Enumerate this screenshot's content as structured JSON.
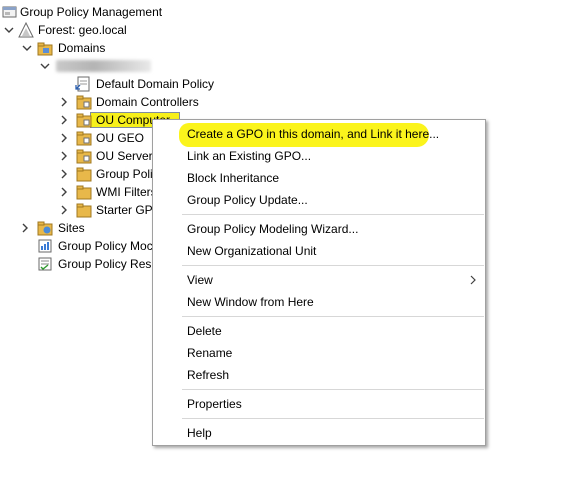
{
  "tree": {
    "root_label": "Group Policy Management",
    "forest_label": "Forest: geo.local",
    "domains_label": "Domains",
    "domain_children": [
      "Default Domain Policy",
      "Domain Controllers",
      "OU Computer",
      "OU GEO",
      "OU Server",
      "Group Poli",
      "WMI Filters",
      "Starter GPO"
    ],
    "sites_label": "Sites",
    "modeling_label": "Group Policy Moc",
    "results_label": "Group Policy Resu"
  },
  "context_menu": {
    "create_gpo": "Create a GPO in this domain, and Link it here...",
    "link_existing": "Link an Existing GPO...",
    "block_inheritance": "Block Inheritance",
    "gp_update": "Group Policy Update...",
    "modeling_wizard": "Group Policy Modeling Wizard...",
    "new_ou": "New Organizational Unit",
    "view": "View",
    "new_window": "New Window from Here",
    "delete": "Delete",
    "rename": "Rename",
    "refresh": "Refresh",
    "properties": "Properties",
    "help": "Help"
  },
  "colors": {
    "highlight": "#f7f01a",
    "folder": "#e8b84a"
  },
  "icons": [
    "gpm-icon",
    "forest-icon",
    "domains-icon",
    "gpo-link-icon",
    "ou-folder-icon",
    "sites-icon",
    "modeling-icon",
    "results-icon",
    "chevron-right-icon",
    "chevron-down-icon"
  ]
}
